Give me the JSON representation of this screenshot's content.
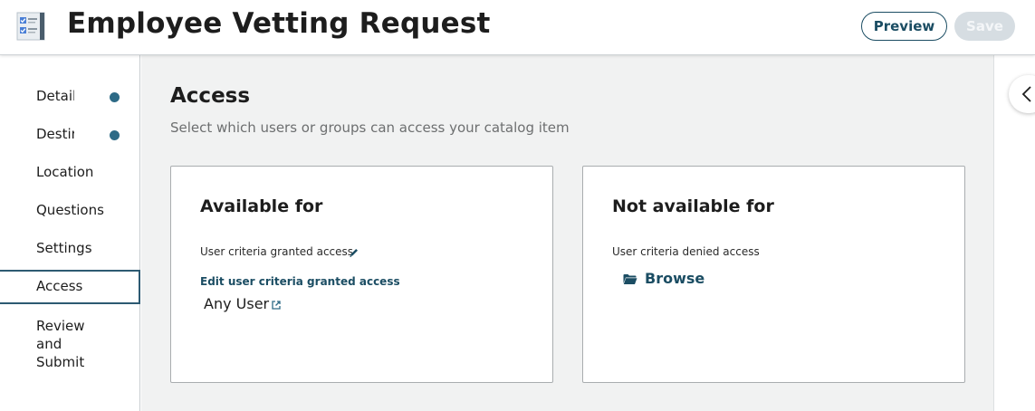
{
  "header": {
    "title": "Employee Vetting Request",
    "app_icon": "checklist-form-icon",
    "preview_label": "Preview",
    "save_label": "Save"
  },
  "sidebar": {
    "items": [
      {
        "label": "Details",
        "status_dot": true
      },
      {
        "label": "Destination",
        "status_dot": true
      },
      {
        "label": "Location",
        "status_dot": false
      },
      {
        "label": "Questions",
        "status_dot": false
      },
      {
        "label": "Settings",
        "status_dot": false
      },
      {
        "label": "Access",
        "status_dot": false,
        "active": true
      },
      {
        "label": "Review and Submit",
        "status_dot": false
      }
    ]
  },
  "main": {
    "title": "Access",
    "subtitle": "Select which users or groups can access your catalog item",
    "available": {
      "title": "Available for",
      "criteria_label": "User criteria granted access",
      "edit_link": "Edit user criteria granted access",
      "value": "Any User"
    },
    "not_available": {
      "title": "Not available for",
      "criteria_label": "User criteria denied access",
      "browse_label": "Browse"
    }
  },
  "colors": {
    "accent": "#1b4d63",
    "status_dot": "#2d6a86",
    "main_bg": "#f1f2f2",
    "save_disabled_bg": "#d6dde2"
  }
}
